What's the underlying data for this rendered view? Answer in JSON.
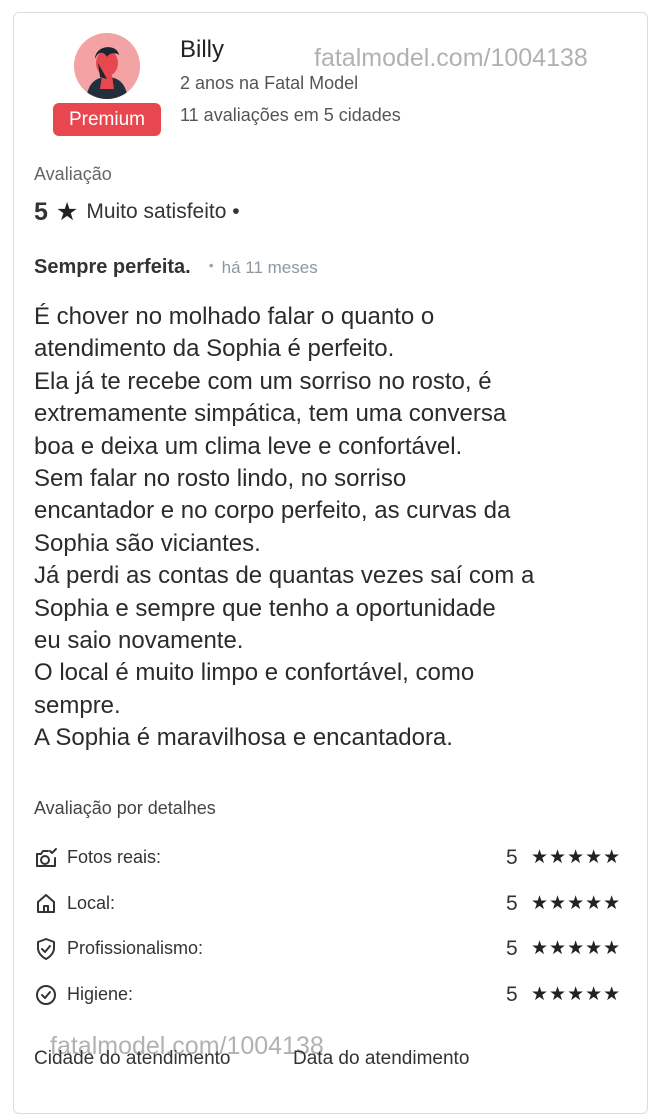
{
  "reviewer": {
    "name": "Billy",
    "tenure": "2 anos na Fatal Model",
    "reviews_summary": "11 avaliações em 5 cidades",
    "badge": "Premium",
    "avatar_icon": "user-avatar-icon"
  },
  "watermarks": {
    "top": "fatalmodel.com/1004138",
    "bottom": "fatalmodel.com/1004138"
  },
  "rating": {
    "section_label": "Avaliação",
    "score": "5",
    "star": "★",
    "description": "Muito satisfeito •"
  },
  "review": {
    "title": "Sempre perfeita.",
    "separator": "•",
    "time_ago": "há 11 meses",
    "body_lines": [
      "É chover no molhado falar o quanto o",
      "atendimento da Sophia é perfeito.",
      "Ela já te recebe com um sorriso no rosto, é",
      "extremamente simpática, tem uma conversa",
      "boa e deixa um clima leve e confortável.",
      "Sem falar no rosto lindo, no sorriso",
      "encantador e no corpo perfeito, as curvas da",
      "Sophia são viciantes.",
      "Já perdi as contas de quantas vezes saí com a",
      "Sophia e sempre que tenho a oportunidade",
      "eu saio novamente.",
      "O local é muito limpo e confortável, como",
      "sempre.",
      "A Sophia é maravilhosa e encantadora."
    ]
  },
  "details": {
    "section_label": "Avaliação por detalhes",
    "items": [
      {
        "label": "Fotos reais:",
        "score": "5",
        "stars": "★★★★★",
        "icon": "camera-check-icon"
      },
      {
        "label": "Local:",
        "score": "5",
        "stars": "★★★★★",
        "icon": "home-icon"
      },
      {
        "label": "Profissionalismo:",
        "score": "5",
        "stars": "★★★★★",
        "icon": "shield-check-icon"
      },
      {
        "label": "Higiene:",
        "score": "5",
        "stars": "★★★★★",
        "icon": "check-circle-icon"
      }
    ]
  },
  "footer": {
    "city_label": "Cidade do atendimento",
    "date_label": "Data do atendimento"
  },
  "colors": {
    "badge": "#e8474f",
    "avatar_bg": "#f3a3a3",
    "card_border": "#dcdcdc"
  }
}
